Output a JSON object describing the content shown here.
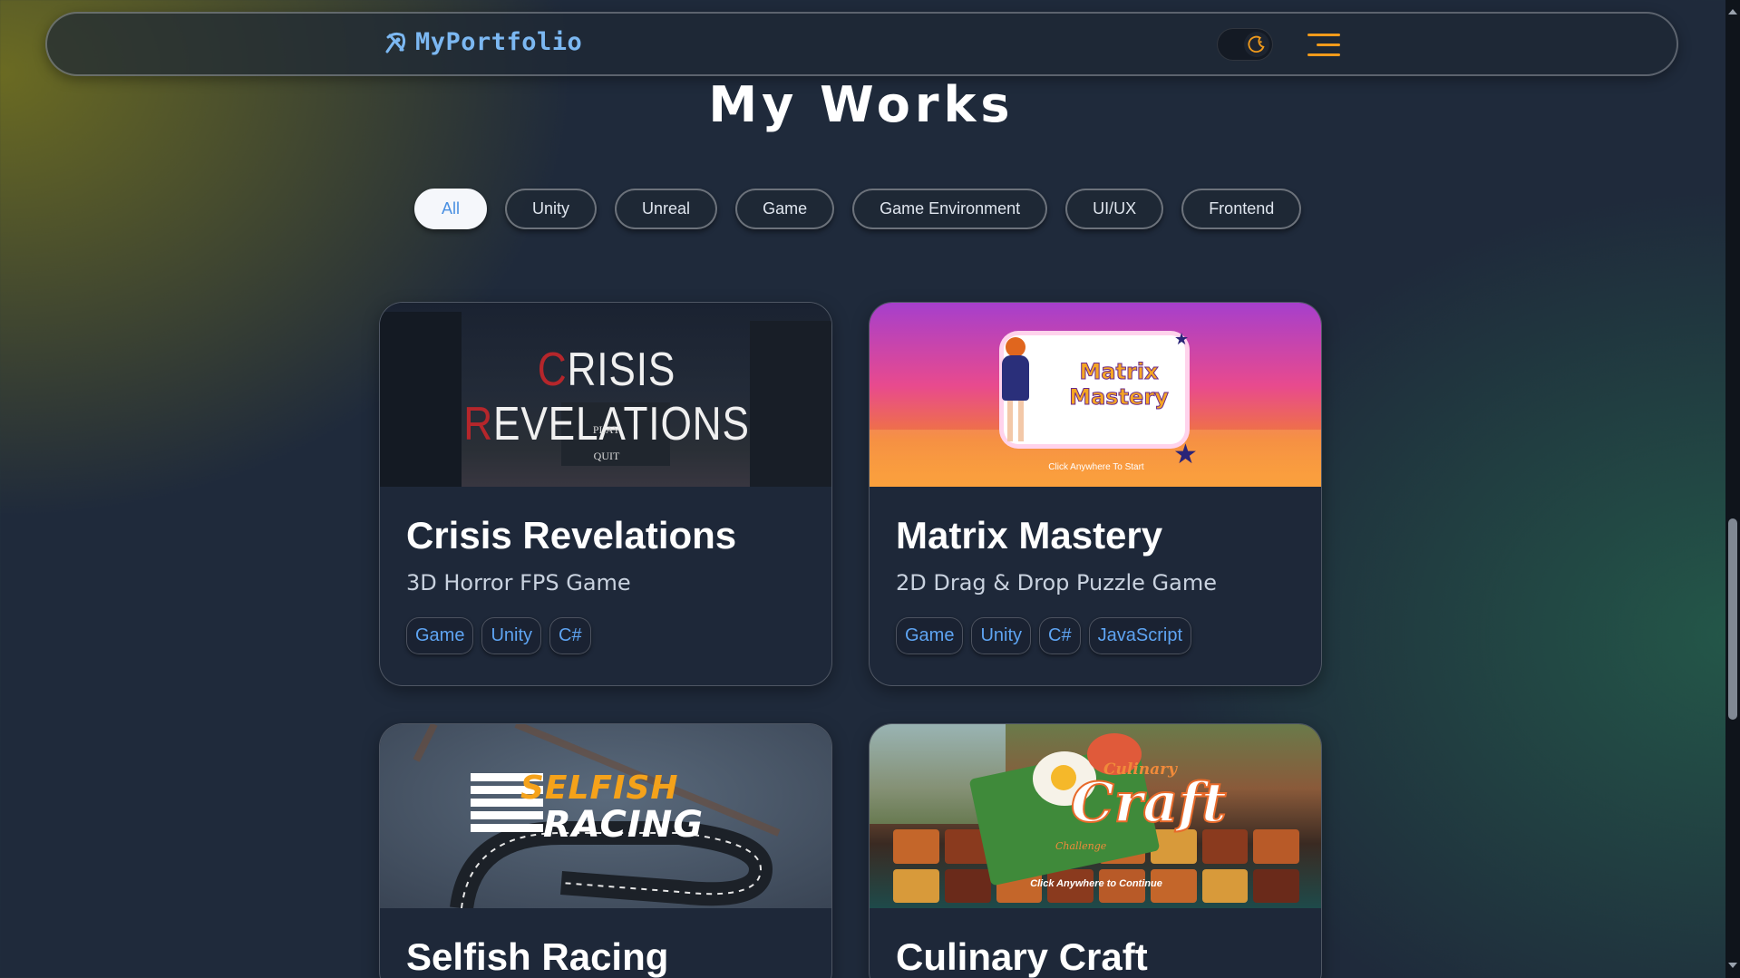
{
  "nav": {
    "brand": "MyPortfolio",
    "theme_toggle_icon": "moon-icon",
    "menu_icon": "hamburger-icon",
    "colors": {
      "brand": "#7cb8f2",
      "accent": "#f29b1b"
    }
  },
  "page_title": "My Works",
  "filters": [
    {
      "label": "All",
      "active": true
    },
    {
      "label": "Unity",
      "active": false
    },
    {
      "label": "Unreal",
      "active": false
    },
    {
      "label": "Game",
      "active": false
    },
    {
      "label": "Game Environment",
      "active": false
    },
    {
      "label": "UI/UX",
      "active": false
    },
    {
      "label": "Frontend",
      "active": false
    }
  ],
  "projects": [
    {
      "title": "Crisis Revelations",
      "subtitle": "3D Horror FPS Game",
      "tags": [
        "Game",
        "Unity",
        "C#"
      ],
      "thumb": {
        "logo_first_c": "C",
        "logo_rest_1": "RISIS ",
        "logo_r": "R",
        "logo_rest_2": "EVELATIONS",
        "menu_play": "PLAY",
        "menu_quit": "QUIT"
      }
    },
    {
      "title": "Matrix Mastery",
      "subtitle": "2D Drag & Drop Puzzle Game",
      "tags": [
        "Game",
        "Unity",
        "C#",
        "JavaScript"
      ],
      "thumb": {
        "logo_line1": "Matrix",
        "logo_line2": "Mastery",
        "caption": "Click Anywhere To Start"
      }
    },
    {
      "title": "Selfish Racing",
      "subtitle": "",
      "tags": [],
      "thumb": {
        "logo_line1": "SELFISH",
        "logo_line2": "RACING"
      }
    },
    {
      "title": "Culinary Craft",
      "subtitle": "",
      "tags": [],
      "thumb": {
        "logo_small": "Culinary",
        "logo_big": "Craft",
        "logo_tag": "Challenge",
        "caption": "Click Anywhere to Continue"
      }
    }
  ]
}
